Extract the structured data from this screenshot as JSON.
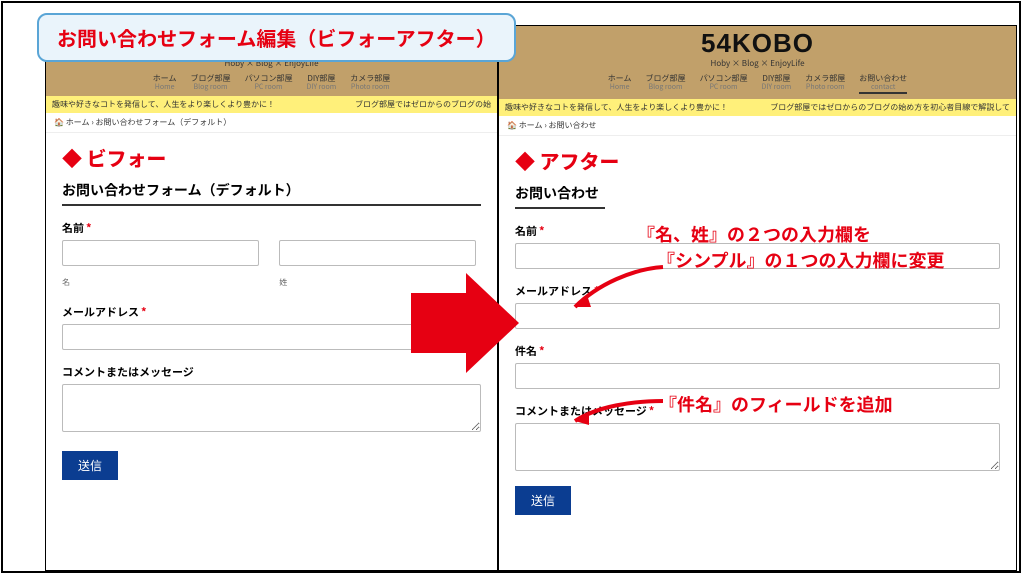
{
  "title_pill": "お問い合わせフォーム編集（ビフォーアフター）",
  "brand": "54KOBO",
  "tagline": "Hoby × Blog × EnjoyLife",
  "nav": [
    {
      "jp": "ホーム",
      "en": "Home"
    },
    {
      "jp": "ブログ部屋",
      "en": "Blog room"
    },
    {
      "jp": "パソコン部屋",
      "en": "PC room"
    },
    {
      "jp": "DIY部屋",
      "en": "DIY room"
    },
    {
      "jp": "カメラ部屋",
      "en": "Photo room"
    },
    {
      "jp": "お問い合わせ",
      "en": "contact"
    }
  ],
  "ticker_left": "趣味や好きなコトを発信して、人生をより楽しくより豊かに！",
  "ticker_right_before": "ブログ部屋ではゼロからのブログの始",
  "ticker_right_after": "ブログ部屋ではゼロからのブログの始め方を初心者目線で解説して",
  "breadcrumb_home": "ホーム",
  "breadcrumb_before": "お問い合わせフォーム（デフォルト）",
  "breadcrumb_after": "お問い合わせ",
  "section_before": "◆ ビフォー",
  "section_after": "◆ アフター",
  "form_title_before": "お問い合わせフォーム（デフォルト）",
  "form_title_after": "お問い合わせ",
  "labels": {
    "name": "名前",
    "first": "名",
    "last": "姓",
    "email": "メールアドレス",
    "subject": "件名",
    "comment_before": "コメントまたはメッセージ",
    "comment_after": "コメントまたはメッセージ",
    "required": "*",
    "submit": "送信"
  },
  "annotations": {
    "line1": "『名、姓』の２つの入力欄を",
    "line2": "『シンプル』の１つの入力欄に変更",
    "line3": "『件名』のフィールドを追加"
  }
}
